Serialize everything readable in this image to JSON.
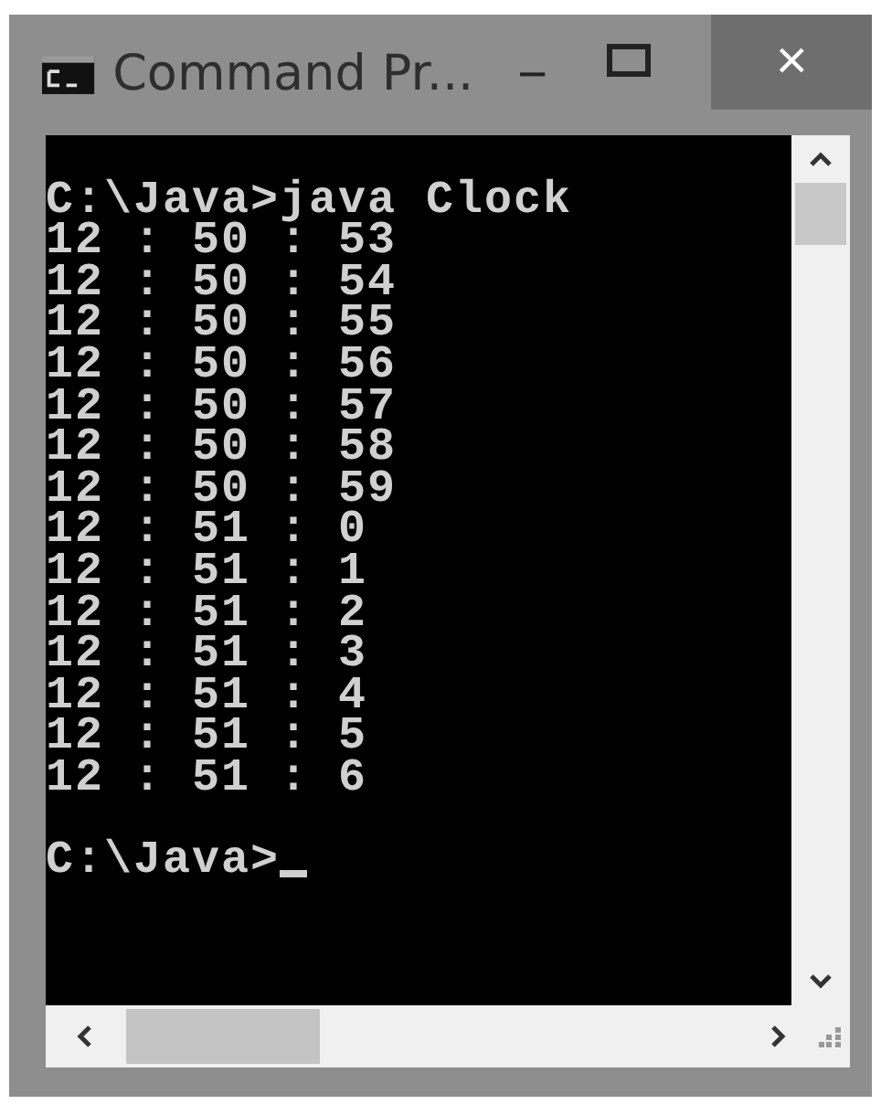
{
  "window": {
    "title": "Command Pr...",
    "controls": [
      "−",
      "×"
    ]
  },
  "console": {
    "lines": [
      "C:\\Java>java Clock",
      "12 : 50 : 53",
      "12 : 50 : 54",
      "12 : 50 : 55",
      "12 : 50 : 56",
      "12 : 50 : 57",
      "12 : 50 : 58",
      "12 : 50 : 59",
      "12 : 51 : 0",
      "12 : 51 : 1",
      "12 : 51 : 2",
      "12 : 51 : 3",
      "12 : 51 : 4",
      "12 : 51 : 5",
      "12 : 51 : 6"
    ],
    "prompt": "C:\\Java>"
  }
}
